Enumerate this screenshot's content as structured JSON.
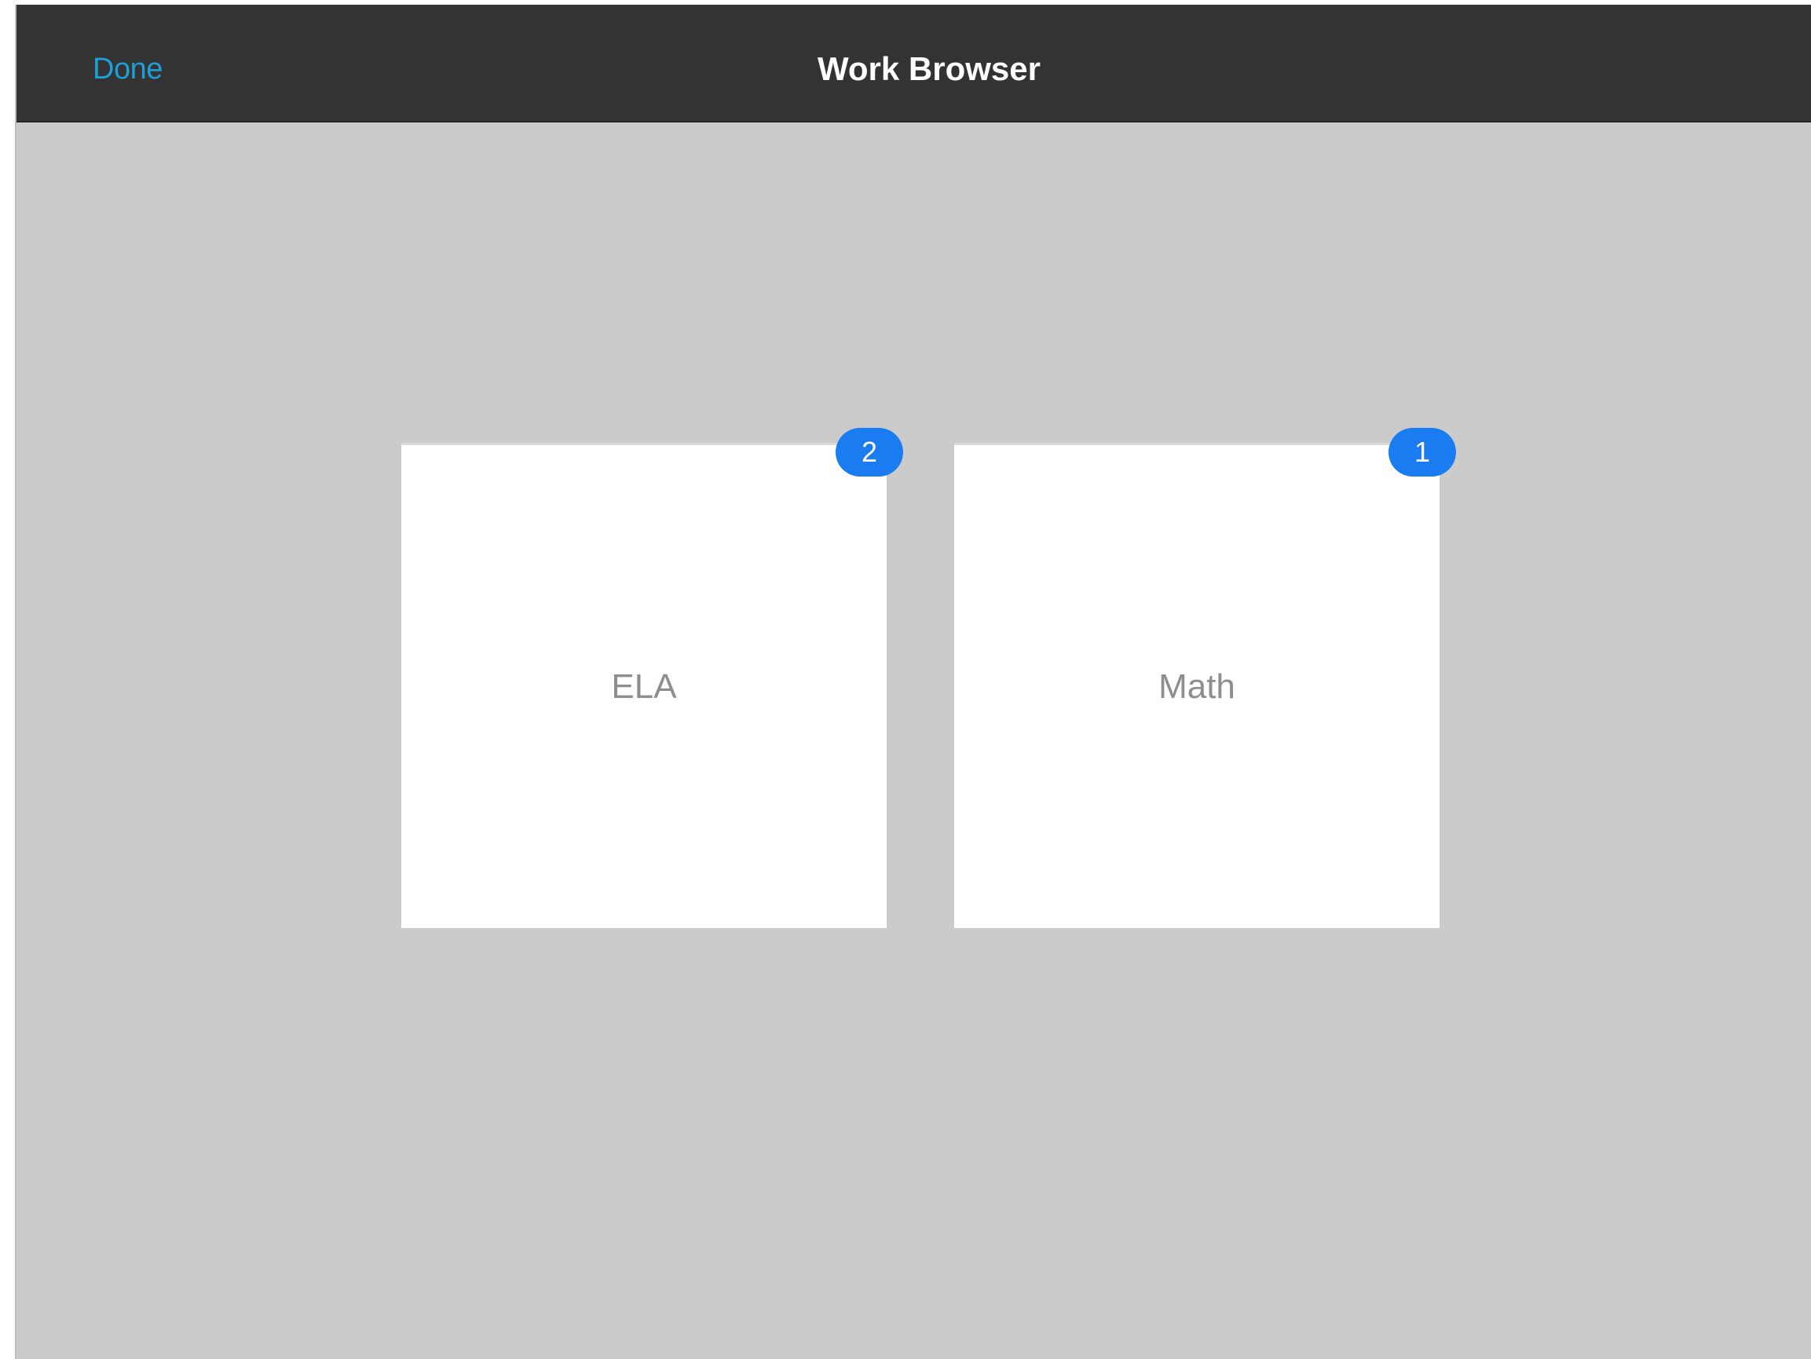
{
  "navbar": {
    "done_label": "Done",
    "title": "Work Browser"
  },
  "folders": [
    {
      "label": "ELA",
      "count": "2"
    },
    {
      "label": "Math",
      "count": "1"
    }
  ],
  "colors": {
    "navbar_background": "#333333",
    "content_background": "#cbcbcb",
    "accent_link": "#1e9fd6",
    "badge": "#1b7cf2",
    "card": "#ffffff",
    "card_label": "#8e8e8e"
  }
}
